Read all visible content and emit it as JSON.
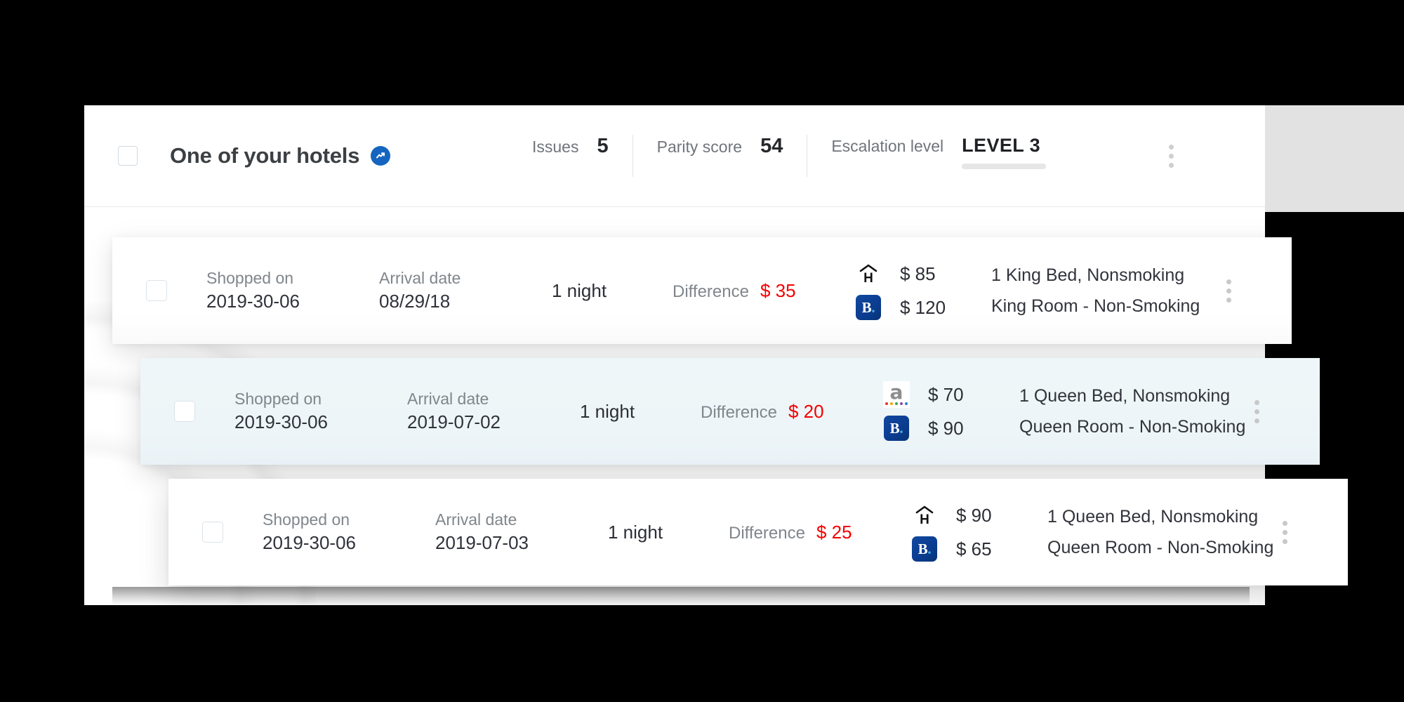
{
  "header": {
    "hotel_name": "One of your hotels",
    "verified_icon": "verified-chart-badge-icon",
    "stats": [
      {
        "label": "Issues",
        "value": "5"
      },
      {
        "label": "Parity score",
        "value": "54"
      }
    ],
    "escalation": {
      "label": "Escalation level",
      "value": "LEVEL 3",
      "progress_percent": 55,
      "bar_color": "#f5a623"
    },
    "kebab_icon": "more-options-icon"
  },
  "colors": {
    "difference": "#f40000",
    "accent_blue": "#1565c0",
    "selected_row": "#edf5f8",
    "escalation": "#f5a623"
  },
  "rows": [
    {
      "shopped_label": "Shopped on",
      "shopped_value": "2019-30-06",
      "arrival_label": "Arrival date",
      "arrival_value": "08/29/18",
      "nights": "1 night",
      "difference_label": "Difference",
      "difference_value": "$ 35",
      "offers": [
        {
          "provider": "hotels-com-icon",
          "price": "$ 85",
          "room": "1 King Bed, Nonsmoking"
        },
        {
          "provider": "booking-com-icon",
          "price": "$ 120",
          "room": "King Room - Non-Smoking"
        }
      ],
      "selected": false
    },
    {
      "shopped_label": "Shopped on",
      "shopped_value": "2019-30-06",
      "arrival_label": "Arrival date",
      "arrival_value": "2019-07-02",
      "nights": "1 night",
      "difference_label": "Difference",
      "difference_value": "$ 20",
      "offers": [
        {
          "provider": "amazon-icon",
          "price": "$ 70",
          "room": "1 Queen Bed, Nonsmoking"
        },
        {
          "provider": "booking-com-icon",
          "price": "$ 90",
          "room": "Queen Room - Non-Smoking"
        }
      ],
      "selected": true
    },
    {
      "shopped_label": "Shopped on",
      "shopped_value": "2019-30-06",
      "arrival_label": "Arrival date",
      "arrival_value": "2019-07-03",
      "nights": "1 night",
      "difference_label": "Difference",
      "difference_value": "$ 25",
      "offers": [
        {
          "provider": "hotels-com-icon",
          "price": "$ 90",
          "room": "1 Queen Bed, Nonsmoking"
        },
        {
          "provider": "booking-com-icon",
          "price": "$ 65",
          "room": "Queen Room - Non-Smoking"
        }
      ],
      "selected": false
    }
  ]
}
